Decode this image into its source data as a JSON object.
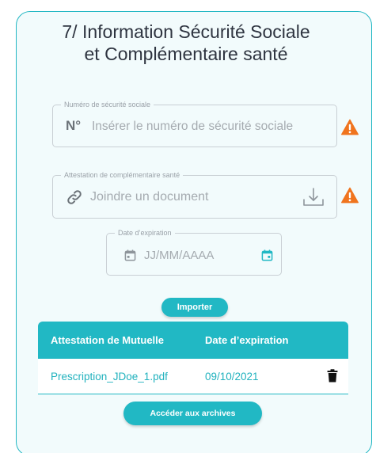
{
  "title": {
    "line1": "7/ Information Sécurité Sociale",
    "line2": "et Complémentaire santé"
  },
  "ssn_field": {
    "label": "Numéro de sécurité sociale",
    "prefix": "N°",
    "placeholder": "Insérer le numéro de sécurité sociale",
    "status_icon": "warning-icon"
  },
  "attestation_field": {
    "label": "Attestation de complémentaire santé",
    "placeholder": "Joindre un document",
    "leading_icon": "link-icon",
    "trailing_icon": "upload-icon",
    "status_icon": "warning-icon"
  },
  "expiry_field": {
    "label": "Date d’expiration",
    "placeholder": "JJ/MM/AAAA",
    "leading_icon": "calendar-icon",
    "trailing_icon": "calendar-icon"
  },
  "import_button": {
    "label": "Importer"
  },
  "table": {
    "headers": [
      "Attestation de Mutuelle",
      "Date d’expiration"
    ],
    "rows": [
      {
        "file": "Prescription_JDoe_1.pdf",
        "date": "09/10/2021",
        "action_icon": "trash-icon"
      }
    ]
  },
  "archive_button": {
    "label": "Accéder aux archives"
  },
  "colors": {
    "accent": "#21b8c4",
    "warning": "#f0741e",
    "card_background": "#f2fbfc",
    "text": "#2e3440"
  }
}
